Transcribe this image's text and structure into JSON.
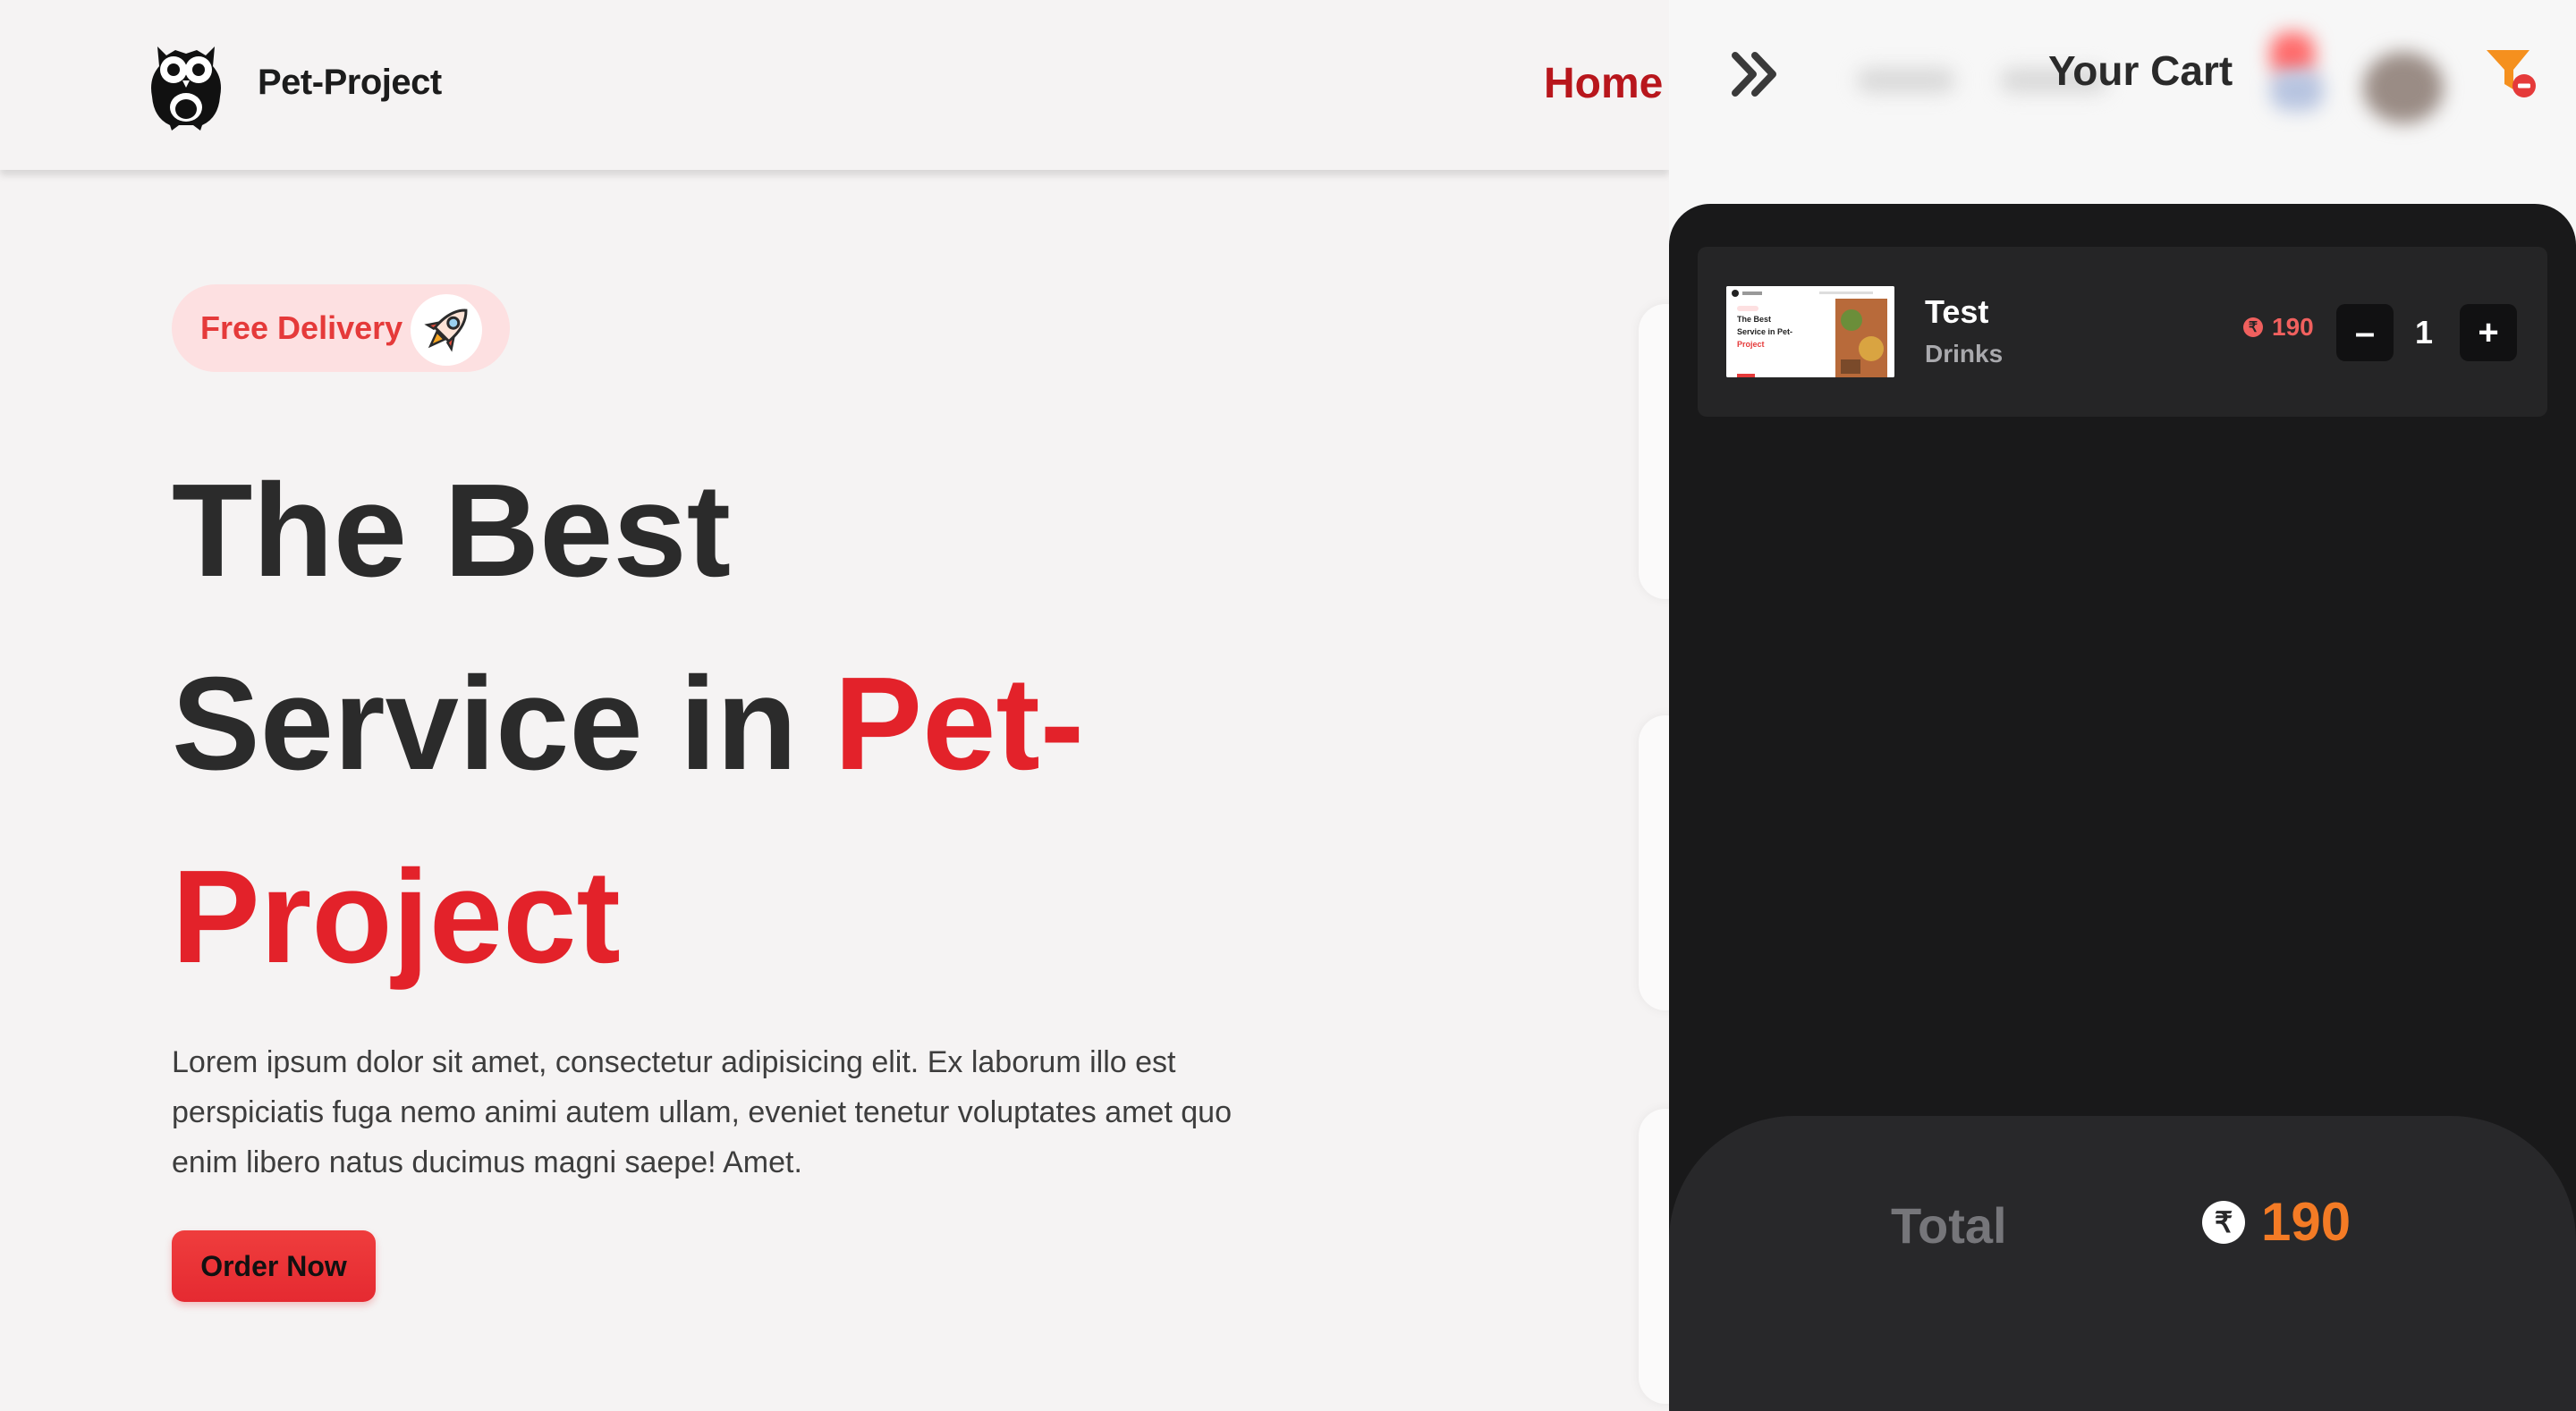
{
  "brand": {
    "name": "Pet-Project"
  },
  "nav": {
    "home": "Home"
  },
  "hero": {
    "badge": "Free Delivery",
    "title_line1": "The Best",
    "title_line2_prefix": "Service in ",
    "title_line2_accent": "Pet-",
    "title_line3_accent": "Project",
    "description": "Lorem ipsum dolor sit amet, consectetur adipisicing elit. Ex laborum illo est perspiciatis fuga nemo animi autem ullam, eveniet tenetur voluptates amet quo enim libero natus ducimus magni saepe! Amet.",
    "cta": "Order Now"
  },
  "cart": {
    "title": "Your Cart",
    "items": [
      {
        "name": "Test",
        "category": "Drinks",
        "price": "190",
        "quantity": "1",
        "decrement": "–",
        "increment": "+"
      }
    ],
    "total_label": "Total",
    "total_value": "190",
    "currency_symbol": "₹"
  },
  "thumbnail": {
    "title_line1": "The Best",
    "title_line2": "Service in Pet-",
    "title_line3": "Project"
  },
  "colors": {
    "accent_red": "#e3222a",
    "nav_active": "#b8161c",
    "price_red": "#f0605e",
    "total_orange": "#f47b25",
    "drawer_bg": "#19191a",
    "filter_orange": "#f5901e"
  },
  "icons": {
    "logo": "owl-icon",
    "badge": "rocket-icon",
    "collapse": "double-chevron-right-icon",
    "filter": "filter-remove-icon",
    "currency": "rupee-icon"
  }
}
